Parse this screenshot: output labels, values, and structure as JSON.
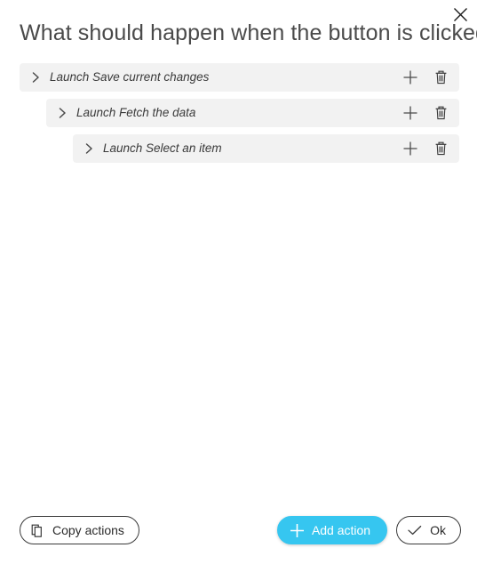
{
  "dialog": {
    "title": "What should happen when the button is clicked?",
    "close_icon": "close-icon",
    "close_label": "Close"
  },
  "actions": {
    "expand_icon": "chevron-right-icon",
    "add_icon": "plus-icon",
    "delete_icon": "trash-icon",
    "add_tooltip": "Add",
    "delete_tooltip": "Delete",
    "rows": [
      {
        "label": "Launch Save current changes",
        "depth": 0
      },
      {
        "label": "Launch Fetch the data",
        "depth": 1
      },
      {
        "label": "Launch Select an item",
        "depth": 2
      }
    ]
  },
  "footer": {
    "copy_label": "Copy actions",
    "copy_icon": "copy-icon",
    "add_action_label": "Add action",
    "add_action_icon": "plus-icon",
    "ok_label": "Ok",
    "ok_icon": "check-icon"
  },
  "colors": {
    "accent": "#36c6f0",
    "row_background": "#f2f2f2",
    "title_text": "#4a4a4a",
    "page_background": "#ffffff"
  }
}
